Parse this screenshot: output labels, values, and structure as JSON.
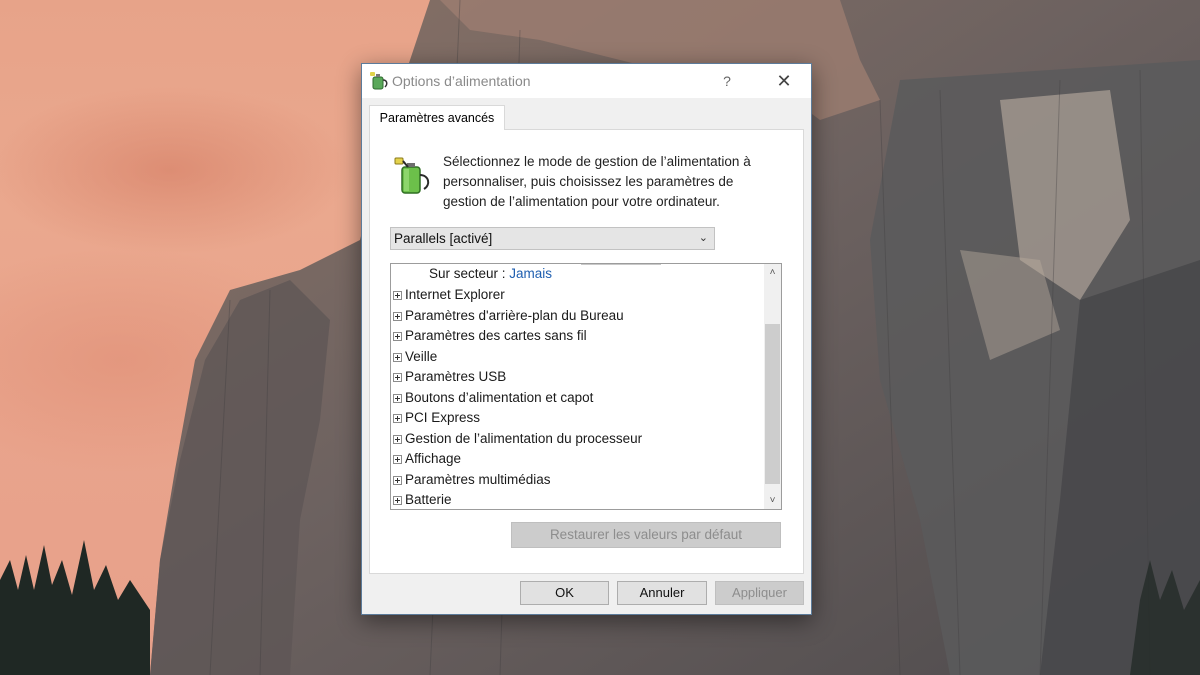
{
  "window": {
    "title": "Options d’alimentation",
    "help_label": "?",
    "close_label": "✕"
  },
  "tab": {
    "label": "Paramètres avancés"
  },
  "description": {
    "line1": "Sélectionnez le mode de gestion de l’alimentation à",
    "line2": "personnaliser, puis choisissez les paramètres de",
    "line3": "gestion de l’alimentation pour votre ordinateur."
  },
  "plan_select": {
    "value": "Parallels [activé]",
    "chevron": "⌄"
  },
  "settings_tree": {
    "sub_setting": {
      "label": "Sur secteur :",
      "value": "Jamais"
    },
    "items": [
      "Internet Explorer",
      "Paramètres d'arrière-plan du Bureau",
      "Paramètres des cartes sans fil",
      "Veille",
      "Paramètres USB",
      "Boutons d’alimentation et capot",
      "PCI Express",
      "Gestion de l’alimentation du processeur",
      "Affichage",
      "Paramètres multimédias",
      "Batterie"
    ],
    "scroll_up": "˄",
    "scroll_down": "˅"
  },
  "buttons": {
    "restore_defaults": "Restaurer les valeurs par défaut",
    "ok": "OK",
    "cancel": "Annuler",
    "apply": "Appliquer"
  },
  "colors": {
    "accent_link": "#1f5fb0",
    "disabled_text": "#8d8d8d",
    "window_border": "#5c7b9a"
  },
  "icons": {
    "title": "power-options-icon",
    "header": "battery-plug-icon"
  }
}
